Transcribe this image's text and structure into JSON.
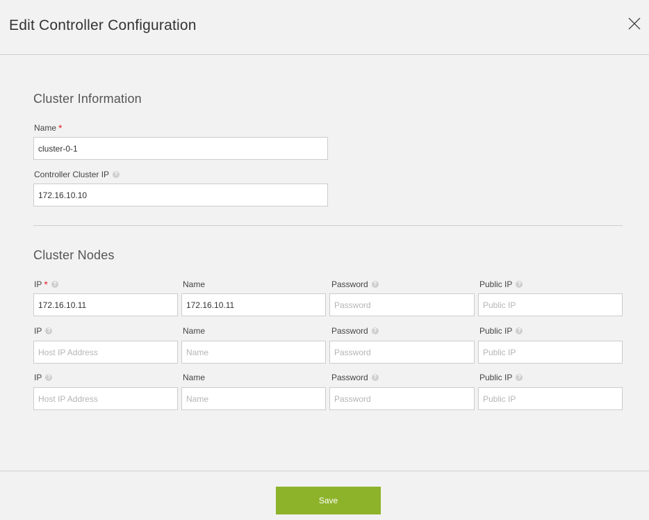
{
  "dialog": {
    "title": "Edit Controller Configuration"
  },
  "cluster_info": {
    "section_title": "Cluster Information",
    "name_label": "Name",
    "name_value": "cluster-0-1",
    "controller_ip_label": "Controller Cluster IP",
    "controller_ip_value": "172.16.10.10"
  },
  "cluster_nodes": {
    "section_title": "Cluster Nodes",
    "headers": {
      "ip": "IP",
      "name": "Name",
      "password": "Password",
      "public_ip": "Public IP"
    },
    "rows": [
      {
        "ip_value": "172.16.10.11",
        "ip_placeholder": "",
        "name_value": "172.16.10.11",
        "name_placeholder": "",
        "password_placeholder": "Password",
        "public_ip_placeholder": "Public IP"
      },
      {
        "ip_value": "",
        "ip_placeholder": "Host IP Address",
        "name_value": "",
        "name_placeholder": "Name",
        "password_placeholder": "Password",
        "public_ip_placeholder": "Public IP"
      },
      {
        "ip_value": "",
        "ip_placeholder": "Host IP Address",
        "name_value": "",
        "name_placeholder": "Name",
        "password_placeholder": "Password",
        "public_ip_placeholder": "Public IP"
      }
    ]
  },
  "footer": {
    "save_label": "Save"
  },
  "icons": {
    "close": "close-icon",
    "help": "help-icon"
  },
  "colors": {
    "save_button": "#8db32a",
    "required": "#e0242a"
  }
}
